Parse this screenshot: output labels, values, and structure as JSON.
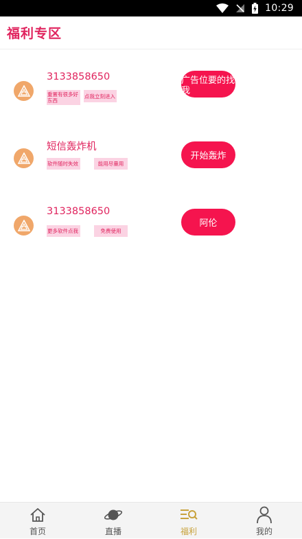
{
  "status_bar": {
    "time": "10:29"
  },
  "header": {
    "title": "福利专区"
  },
  "cards": [
    {
      "title": "3133858650",
      "tags": [
        "重置有很多好东西",
        "点我立刻进入"
      ],
      "button_label": "广告位要的找我"
    },
    {
      "title": "短信轰炸机",
      "tags": [
        "软件随时失效",
        "能用尽量用"
      ],
      "button_label": "开始轰炸"
    },
    {
      "title": "3133858650",
      "tags": [
        "更多软件点我",
        "免费使用"
      ],
      "button_label": "阿伦"
    }
  ],
  "bottom_nav": {
    "items": [
      {
        "label": "首页",
        "icon": "home-icon"
      },
      {
        "label": "直播",
        "icon": "planet-icon"
      },
      {
        "label": "福利",
        "icon": "welfare-icon"
      },
      {
        "label": "我的",
        "icon": "profile-icon"
      }
    ],
    "active": "福利"
  },
  "colors": {
    "accent": "#e0245e",
    "button": "#f5144e",
    "tag_background": "#fbd3e3",
    "avatar": "#f0a76a",
    "nav_active": "#c8a23c"
  }
}
